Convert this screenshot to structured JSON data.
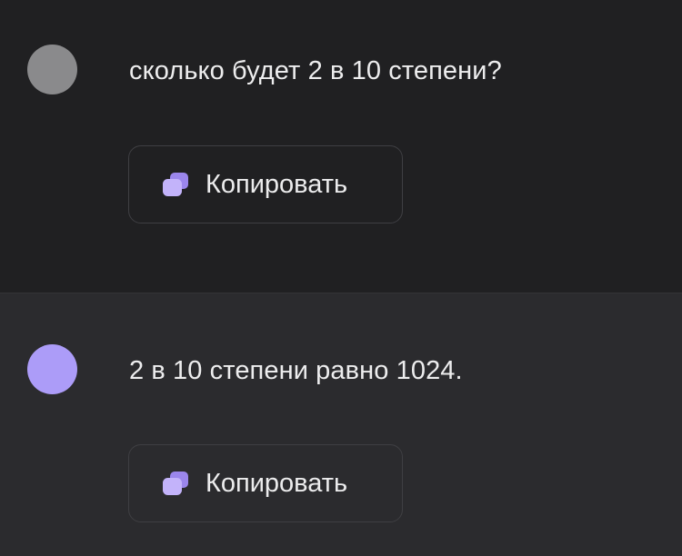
{
  "colors": {
    "user_bg": "#202022",
    "bot_bg": "#2b2b2e",
    "user_avatar": "#8a8a8c",
    "bot_avatar": "#ac9cf8",
    "accent_icon": "#b7a4f7",
    "text": "#ededee"
  },
  "messages": [
    {
      "role": "user",
      "text": "сколько будет 2 в 10 степени?",
      "copy_label": "Копировать",
      "copy_icon": "copy-icon"
    },
    {
      "role": "assistant",
      "text": "2 в 10 степени равно 1024.",
      "copy_label": "Копировать",
      "copy_icon": "copy-icon"
    }
  ]
}
